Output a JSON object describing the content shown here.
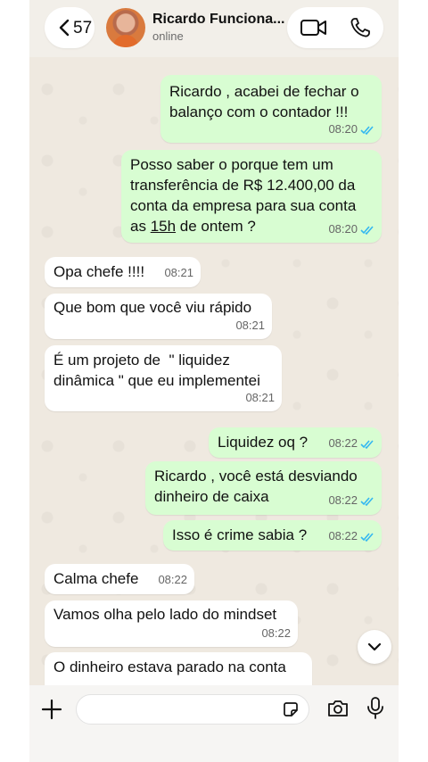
{
  "header": {
    "back_count": "57",
    "contact_name": "Ricardo Funciona...",
    "contact_status": "online",
    "icons": [
      "chevron-left-icon",
      "video-call-icon",
      "phone-icon"
    ]
  },
  "messages": [
    {
      "dir": "out",
      "lines": "Ricardo , acabei de fechar o\nbalanço com o contador !!!",
      "time": "08:20",
      "status": "read"
    },
    {
      "dir": "out",
      "lines": "Posso saber o porque tem um\ntransferência de R$ 12.400,00 da\nconta da empresa para sua conta",
      "last_line_pre": "as ",
      "last_line_underline": "15h",
      "last_line_post": " de ontem ?",
      "time": "08:20",
      "status": "read"
    },
    {
      "dir": "in",
      "lines": "Opa chefe !!!!",
      "time": "08:21"
    },
    {
      "dir": "in",
      "lines": "Que bom que você viu rápido",
      "time": "08:21"
    },
    {
      "dir": "in",
      "lines": "É um projeto de  \" liquidez\ndinâmica \" que eu implementei",
      "time": "08:21"
    },
    {
      "dir": "out",
      "lines": "Liquidez oq ?",
      "time": "08:22",
      "status": "read"
    },
    {
      "dir": "out",
      "lines": "Ricardo , você está desviando\ndinheiro de caixa",
      "time": "08:22",
      "status": "read"
    },
    {
      "dir": "out",
      "lines": "Isso é crime sabia ?",
      "time": "08:22",
      "status": "read"
    },
    {
      "dir": "in",
      "lines": "Calma chefe",
      "time": "08:22"
    },
    {
      "dir": "in",
      "lines": "Vamos olha pelo lado do mindset",
      "time": "08:22"
    },
    {
      "dir": "in",
      "lines": "O dinheiro estava parado na conta"
    }
  ],
  "colors": {
    "outgoing_bubble": "#d8fdd2",
    "incoming_bubble": "#ffffff",
    "read_ticks": "#34b7f1",
    "chat_background": "#efe9e0"
  },
  "input": {
    "icons": [
      "plus-icon",
      "sticker-icon",
      "camera-icon",
      "microphone-icon"
    ]
  }
}
